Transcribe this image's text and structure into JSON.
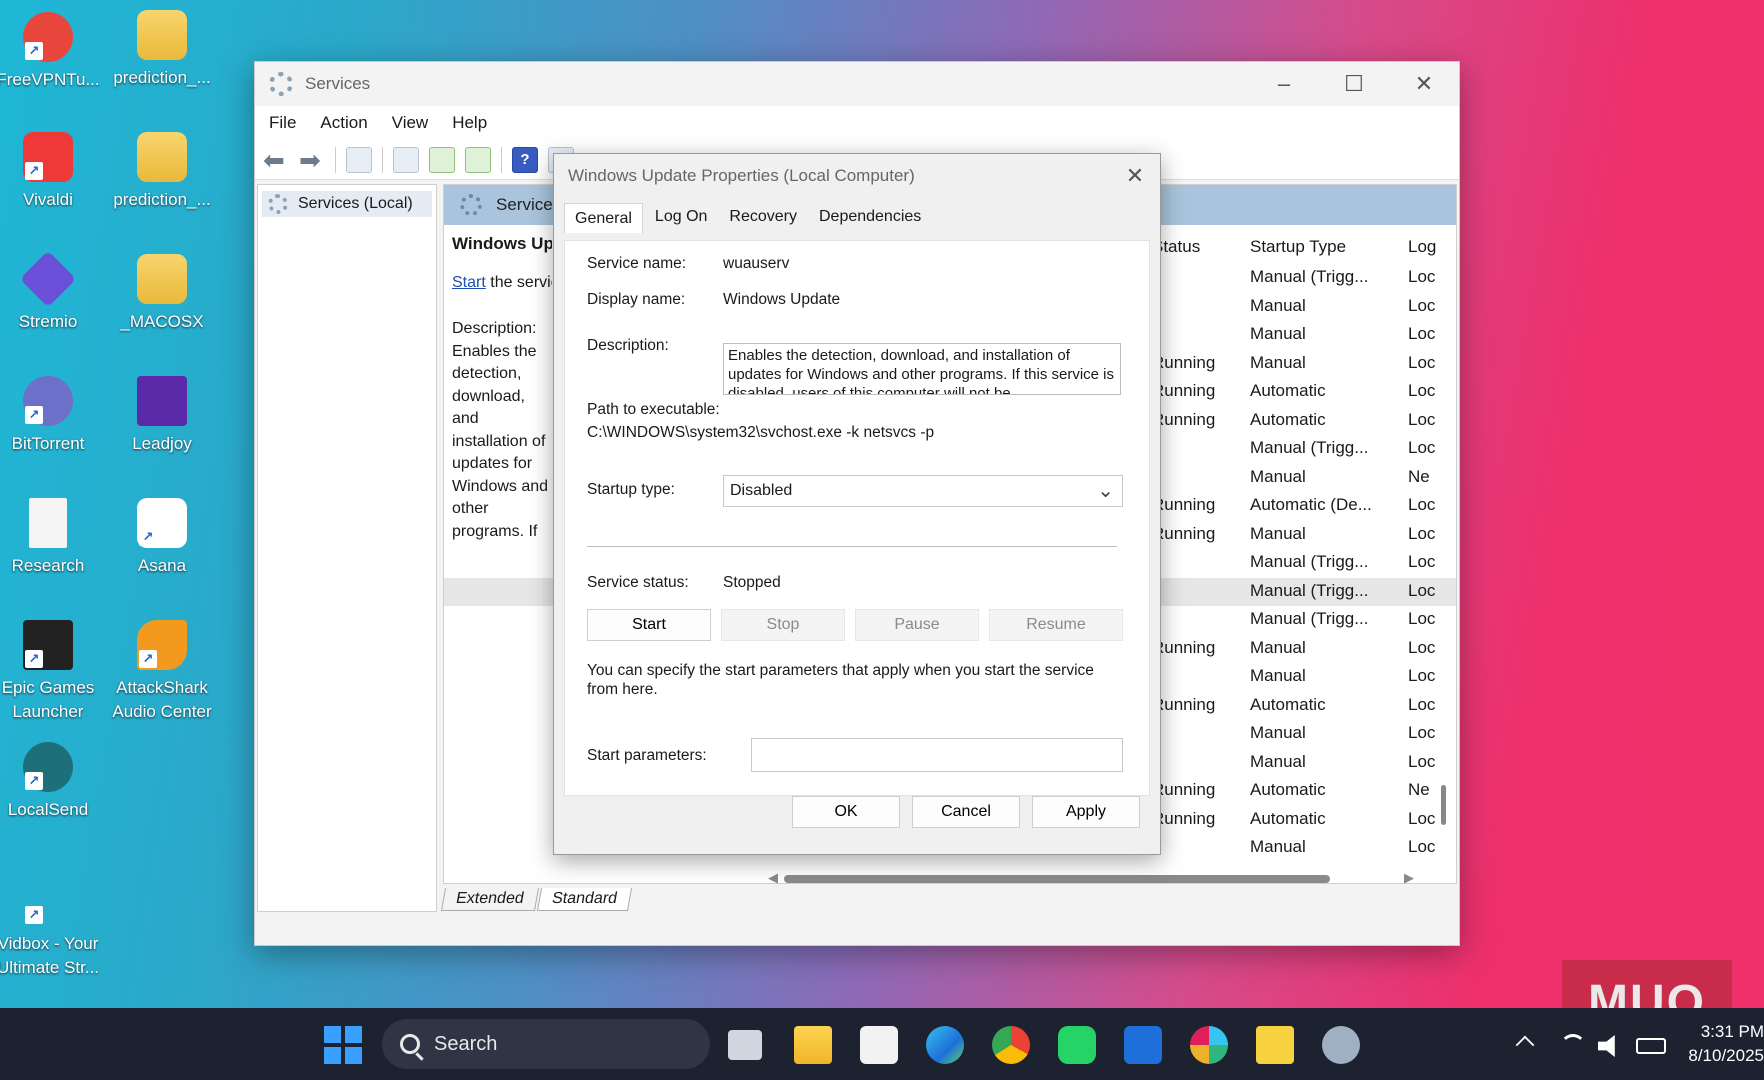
{
  "desktop_icons": [
    {
      "label": "FreeVPNTu..."
    },
    {
      "label": "prediction_..."
    },
    {
      "label": "Vivaldi"
    },
    {
      "label": "prediction_..."
    },
    {
      "label": "Stremio"
    },
    {
      "label": "_MACOSX"
    },
    {
      "label": "BitTorrent"
    },
    {
      "label": "Leadjoy"
    },
    {
      "label": "Research"
    },
    {
      "label": "Asana"
    },
    {
      "label": "Epic Games Launcher"
    },
    {
      "label": "AttackShark Audio Center"
    },
    {
      "label": "LocalSend"
    },
    {
      "label": "Vidbox - Your Ultimate Str..."
    }
  ],
  "services_window": {
    "title": "Services",
    "menu": [
      "File",
      "Action",
      "View",
      "Help"
    ],
    "tree_item": "Services (Local)",
    "pane_header": "Services",
    "selected_service_name": "Windows Update",
    "start_link": "Start",
    "start_suffix": " the service",
    "description_label": "Description:",
    "description_text": "Enables the detection, download, and installation of updates for Windows and other programs. If this service is disabled, users of this computer will not be able to use Windows Update or its automatic updating feature, and programs will not be able to use the Windows Update Agent (WUA) API.",
    "columns": {
      "status": "Status",
      "startup_type": "Startup Type",
      "log_on": "Log"
    },
    "rows": [
      {
        "status": "",
        "startup": "Manual (Trigg...",
        "logon": "Loc"
      },
      {
        "status": "",
        "startup": "Manual",
        "logon": "Loc"
      },
      {
        "status": "",
        "startup": "Manual",
        "logon": "Loc"
      },
      {
        "status": "Running",
        "startup": "Manual",
        "logon": "Loc"
      },
      {
        "status": "Running",
        "startup": "Automatic",
        "logon": "Loc"
      },
      {
        "status": "Running",
        "startup": "Automatic",
        "logon": "Loc"
      },
      {
        "status": "",
        "startup": "Manual (Trigg...",
        "logon": "Loc"
      },
      {
        "status": "",
        "startup": "Manual",
        "logon": "Ne"
      },
      {
        "status": "Running",
        "startup": "Automatic (De...",
        "logon": "Loc"
      },
      {
        "status": "Running",
        "startup": "Manual",
        "logon": "Loc"
      },
      {
        "status": "",
        "startup": "Manual (Trigg...",
        "logon": "Loc"
      },
      {
        "status": "",
        "startup": "Manual (Trigg...",
        "logon": "Loc"
      },
      {
        "status": "",
        "startup": "Manual (Trigg...",
        "logon": "Loc"
      },
      {
        "status": "Running",
        "startup": "Manual",
        "logon": "Loc"
      },
      {
        "status": "",
        "startup": "Manual",
        "logon": "Loc"
      },
      {
        "status": "Running",
        "startup": "Automatic",
        "logon": "Loc"
      },
      {
        "status": "",
        "startup": "Manual",
        "logon": "Loc"
      },
      {
        "status": "",
        "startup": "Manual",
        "logon": "Loc"
      },
      {
        "status": "Running",
        "startup": "Automatic",
        "logon": "Ne"
      },
      {
        "status": "Running",
        "startup": "Automatic",
        "logon": "Loc"
      },
      {
        "status": "",
        "startup": "Manual",
        "logon": "Loc"
      }
    ],
    "bottom_tabs": [
      "Extended",
      "Standard"
    ]
  },
  "dialog": {
    "title": "Windows Update Properties (Local Computer)",
    "tabs": [
      "General",
      "Log On",
      "Recovery",
      "Dependencies"
    ],
    "service_name_label": "Service name:",
    "service_name": "wuauserv",
    "display_name_label": "Display name:",
    "display_name": "Windows Update",
    "description_label": "Description:",
    "description": "Enables the detection, download, and installation of updates for Windows and other programs. If this service is disabled, users of this computer will not be",
    "path_label": "Path to executable:",
    "path": "C:\\WINDOWS\\system32\\svchost.exe -k netsvcs -p",
    "startup_type_label": "Startup type:",
    "startup_type": "Disabled",
    "status_label": "Service status:",
    "status": "Stopped",
    "buttons": {
      "start": "Start",
      "stop": "Stop",
      "pause": "Pause",
      "resume": "Resume"
    },
    "params_hint": "You can specify the start parameters that apply when you start the service from here.",
    "params_label": "Start parameters:",
    "params_value": "",
    "footer": {
      "ok": "OK",
      "cancel": "Cancel",
      "apply": "Apply"
    }
  },
  "taskbar": {
    "search_label": "Search",
    "time": "3:31 PM",
    "date": "8/10/2025"
  },
  "watermark": "MUO"
}
